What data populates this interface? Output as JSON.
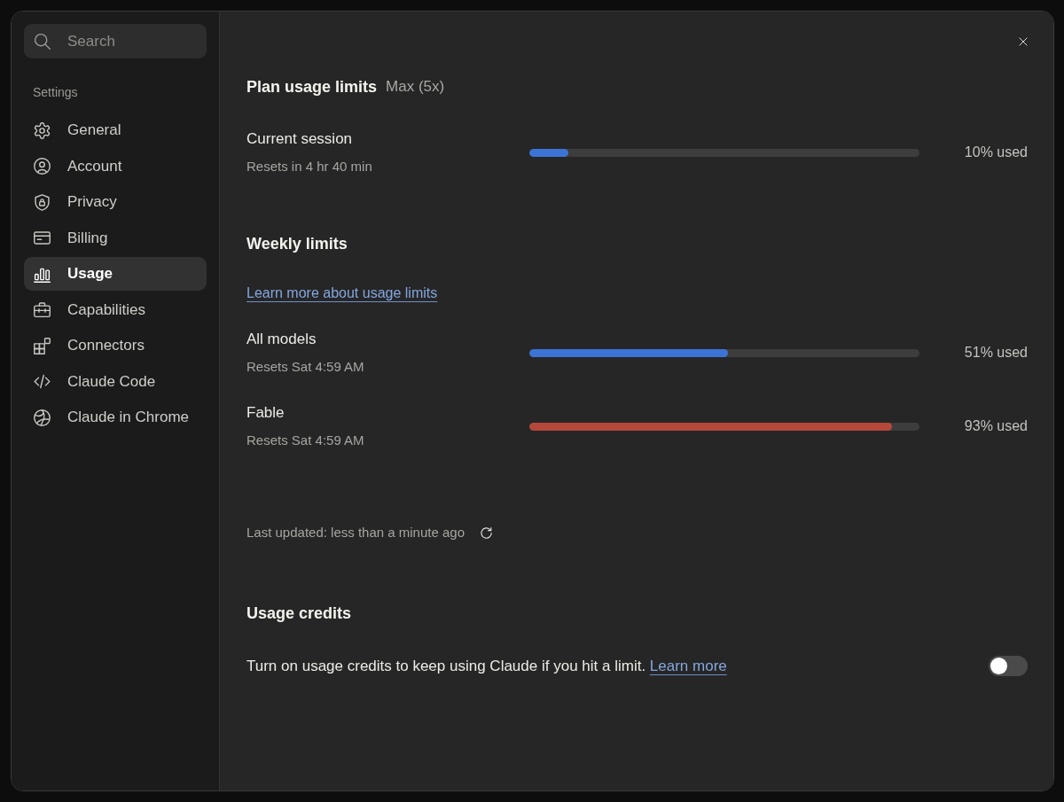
{
  "search": {
    "placeholder": "Search"
  },
  "sidebar": {
    "heading": "Settings",
    "items": [
      {
        "label": "General",
        "selected": false
      },
      {
        "label": "Account",
        "selected": false
      },
      {
        "label": "Privacy",
        "selected": false
      },
      {
        "label": "Billing",
        "selected": false
      },
      {
        "label": "Usage",
        "selected": true
      },
      {
        "label": "Capabilities",
        "selected": false
      },
      {
        "label": "Connectors",
        "selected": false
      },
      {
        "label": "Claude Code",
        "selected": false
      },
      {
        "label": "Claude in Chrome",
        "selected": false
      }
    ]
  },
  "plan": {
    "title": "Plan usage limits",
    "plan_name": "Max (5x)",
    "meters": [
      {
        "label": "Current session",
        "resets": "Resets in 4 hr 40 min",
        "level": 0.1,
        "color": "#3c74d6",
        "reading": "10% used"
      }
    ]
  },
  "weekly": {
    "title": "Weekly limits",
    "link": "Learn more about usage limits",
    "meters": [
      {
        "label": "All models",
        "resets": "Resets Sat 4:59 AM",
        "level": 0.51,
        "color": "#3c74d6",
        "reading": "51% used"
      },
      {
        "label": "Fable",
        "resets": "Resets Sat 4:59 AM",
        "level": 0.93,
        "color": "#b5483a",
        "reading": "93% used"
      }
    ]
  },
  "last_updated": "Last updated: less than a minute ago",
  "credits": {
    "title": "Usage credits",
    "text": "Turn on usage credits to keep using Claude if you hit a limit.",
    "link": "Learn more",
    "on": false
  }
}
